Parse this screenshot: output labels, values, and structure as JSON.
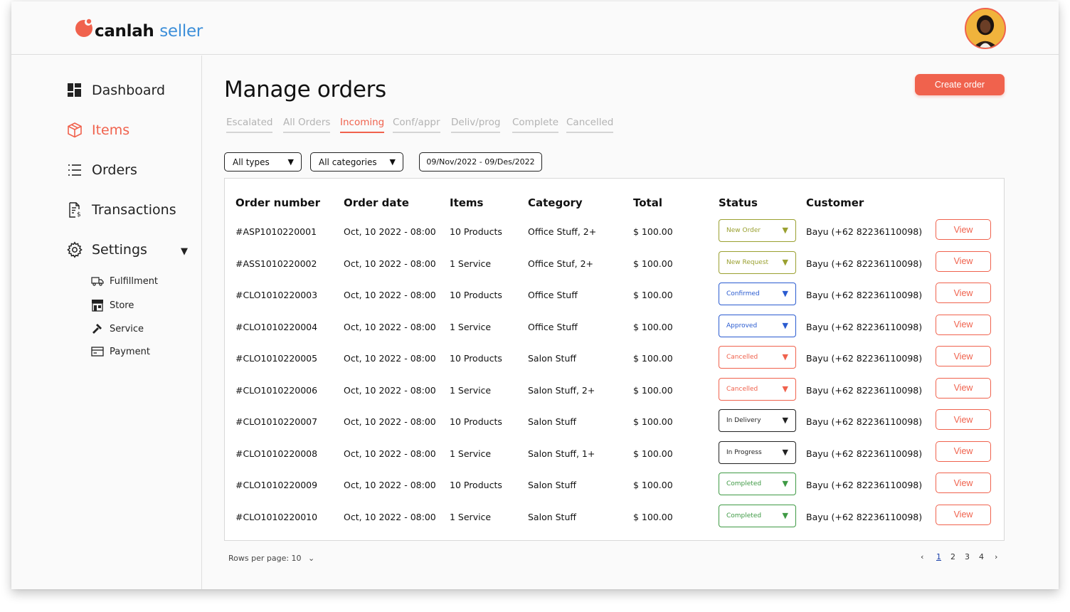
{
  "brand": {
    "name_part1": "canlah",
    "name_part2": "seller",
    "accent": "#f0624d",
    "secondary": "#3d8fd9"
  },
  "user": {
    "avatar_icon": "user-avatar"
  },
  "sidebar": {
    "items": [
      {
        "label": "Dashboard",
        "icon": "dashboard-icon"
      },
      {
        "label": "Items",
        "icon": "box-icon",
        "active": true
      },
      {
        "label": "Orders",
        "icon": "list-icon"
      },
      {
        "label": "Transactions",
        "icon": "receipt-icon"
      },
      {
        "label": "Settings",
        "icon": "gear-icon"
      }
    ],
    "settings_sub": [
      {
        "label": "Fulfillment",
        "icon": "truck-icon"
      },
      {
        "label": "Store",
        "icon": "store-icon"
      },
      {
        "label": "Service",
        "icon": "hammer-icon"
      },
      {
        "label": "Payment",
        "icon": "card-icon"
      }
    ]
  },
  "main": {
    "title": "Manage orders",
    "create_label": "Create order",
    "tabs": [
      {
        "label": "Escalated"
      },
      {
        "label": "All Orders"
      },
      {
        "label": "Incoming",
        "active": true
      },
      {
        "label": "Conf/appr"
      },
      {
        "label": "Deliv/prog"
      },
      {
        "label": "Complete"
      },
      {
        "label": "Cancelled"
      }
    ],
    "filters": {
      "type": "All types",
      "category": "All categories",
      "date_range": "09/Nov/2022 - 09/Des/2022"
    },
    "table": {
      "headers": [
        "Order number",
        "Order date",
        "Items",
        "Category",
        "Total",
        "Status",
        "Customer"
      ],
      "view_label": "View",
      "rows": [
        {
          "order": "#ASP1010220001",
          "date": "Oct, 10 2022 - 08:00",
          "items": "10 Products",
          "category": "Office Stuff, 2+",
          "total": "$ 100.00",
          "status": "New Order",
          "customer": "Bayu (+62 82236110098)"
        },
        {
          "order": "#ASS1010220002",
          "date": "Oct, 10 2022 - 08:00",
          "items": "1 Service",
          "category": "Office Stuf, 2+",
          "total": "$ 100.00",
          "status": "New Request",
          "customer": "Bayu (+62 82236110098)"
        },
        {
          "order": "#CLO1010220003",
          "date": "Oct, 10 2022 - 08:00",
          "items": "10 Products",
          "category": "Office Stuff",
          "total": "$ 100.00",
          "status": "Confirmed",
          "customer": "Bayu (+62 82236110098)"
        },
        {
          "order": "#CLO1010220004",
          "date": "Oct, 10 2022 - 08:00",
          "items": "1 Service",
          "category": "Office Stuff",
          "total": "$ 100.00",
          "status": "Approved",
          "customer": "Bayu (+62 82236110098)"
        },
        {
          "order": "#CLO1010220005",
          "date": "Oct, 10 2022 - 08:00",
          "items": "10 Products",
          "category": "Salon Stuff",
          "total": "$ 100.00",
          "status": "Cancelled",
          "customer": "Bayu (+62 82236110098)"
        },
        {
          "order": "#CLO1010220006",
          "date": "Oct, 10 2022 - 08:00",
          "items": "1 Service",
          "category": "Salon Stuff, 2+",
          "total": "$ 100.00",
          "status": "Cancelled",
          "customer": "Bayu (+62 82236110098)"
        },
        {
          "order": "#CLO1010220007",
          "date": "Oct, 10 2022 - 08:00",
          "items": "10 Products",
          "category": "Salon Stuff",
          "total": "$ 100.00",
          "status": "In Delivery",
          "customer": "Bayu (+62 82236110098)"
        },
        {
          "order": "#CLO1010220008",
          "date": "Oct, 10 2022 - 08:00",
          "items": "1 Service",
          "category": "Salon Stuff, 1+",
          "total": "$ 100.00",
          "status": "In Progress",
          "customer": "Bayu (+62 82236110098)"
        },
        {
          "order": "#CLO1010220009",
          "date": "Oct, 10 2022 - 08:00",
          "items": "10 Products",
          "category": "Salon Stuff",
          "total": "$ 100.00",
          "status": "Completed",
          "customer": "Bayu (+62 82236110098)"
        },
        {
          "order": "#CLO1010220010",
          "date": "Oct, 10 2022 - 08:00",
          "items": "1 Service",
          "category": "Salon Stuff",
          "total": "$ 100.00",
          "status": "Completed",
          "customer": "Bayu (+62 82236110098)"
        }
      ]
    },
    "status_colors": {
      "New Order": "#9aa030",
      "New Request": "#9aa030",
      "Confirmed": "#2a5bd0",
      "Approved": "#2a5bd0",
      "Cancelled": "#f0624d",
      "In Delivery": "#222222",
      "In Progress": "#222222",
      "Completed": "#3f9a45"
    },
    "pagination": {
      "rows_per_page": "Rows per page: 10",
      "pages": [
        "1",
        "2",
        "3",
        "4"
      ],
      "current": "1"
    }
  }
}
